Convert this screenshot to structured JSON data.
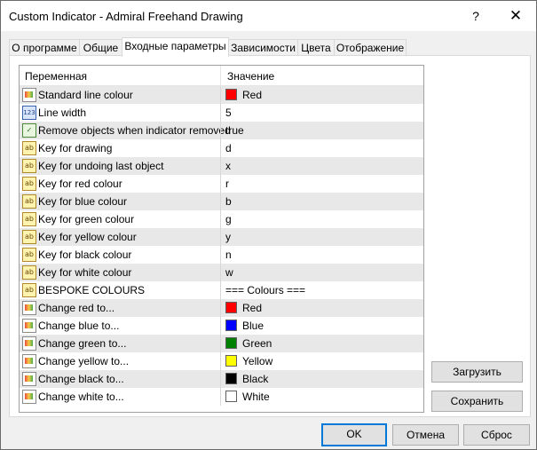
{
  "window": {
    "title": "Custom Indicator - Admiral Freehand Drawing",
    "help": "?",
    "close": "✕"
  },
  "tabs": [
    "О программе",
    "Общие",
    "Входные параметры",
    "Зависимости",
    "Цвета",
    "Отображение"
  ],
  "active_tab": "Входные параметры",
  "grid": {
    "col_variable": "Переменная",
    "col_value": "Значение",
    "rows": [
      {
        "name": "Standard line colour",
        "value": "Red",
        "type": "color",
        "color": "#ff0000"
      },
      {
        "name": "Line width",
        "value": "5",
        "type": "int"
      },
      {
        "name": "Remove objects when indicator removed",
        "value": "true",
        "type": "bool"
      },
      {
        "name": "Key for drawing",
        "value": "d",
        "type": "string"
      },
      {
        "name": "Key for undoing last object",
        "value": "x",
        "type": "string"
      },
      {
        "name": "Key for red colour",
        "value": "r",
        "type": "string"
      },
      {
        "name": "Key for blue colour",
        "value": "b",
        "type": "string"
      },
      {
        "name": "Key for green colour",
        "value": "g",
        "type": "string"
      },
      {
        "name": "Key for yellow colour",
        "value": "y",
        "type": "string"
      },
      {
        "name": "Key for black colour",
        "value": "n",
        "type": "string"
      },
      {
        "name": "Key for white colour",
        "value": "w",
        "type": "string"
      },
      {
        "name": "BESPOKE COLOURS",
        "value": "=== Colours ===",
        "type": "string"
      },
      {
        "name": "Change red to...",
        "value": "Red",
        "type": "color",
        "color": "#ff0000"
      },
      {
        "name": "Change blue to...",
        "value": "Blue",
        "type": "color",
        "color": "#0000ff"
      },
      {
        "name": "Change green to...",
        "value": "Green",
        "type": "color",
        "color": "#008000"
      },
      {
        "name": "Change yellow to...",
        "value": "Yellow",
        "type": "color",
        "color": "#ffff00"
      },
      {
        "name": "Change black to...",
        "value": "Black",
        "type": "color",
        "color": "#000000"
      },
      {
        "name": "Change white to...",
        "value": "White",
        "type": "color",
        "color": "#ffffff"
      }
    ]
  },
  "buttons": {
    "load": "Загрузить",
    "save": "Сохранить",
    "ok": "OK",
    "cancel": "Отмена",
    "reset": "Сброс"
  },
  "icons": {
    "string": "ab",
    "int": "123",
    "bool": "✓",
    "color": "color-palette-icon"
  }
}
